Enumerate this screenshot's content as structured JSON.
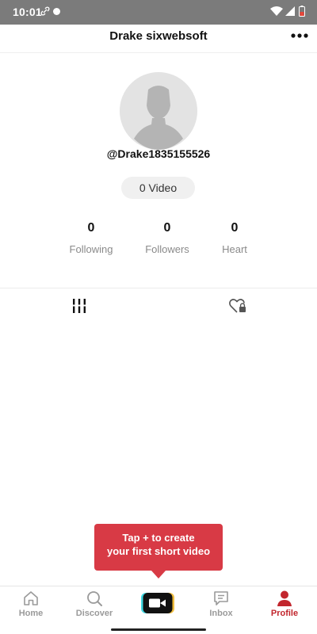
{
  "status_bar": {
    "time": "10:01"
  },
  "header": {
    "title": "Drake sixwebsoft",
    "more_icon": "more-horizontal-icon"
  },
  "profile": {
    "username": "@Drake1835155526",
    "video_count_label": "0 Video",
    "stats": [
      {
        "value": "0",
        "label": "Following"
      },
      {
        "value": "0",
        "label": "Followers"
      },
      {
        "value": "0",
        "label": "Heart"
      }
    ]
  },
  "tabs": [
    {
      "icon": "grid-columns-icon"
    },
    {
      "icon": "liked-lock-icon"
    }
  ],
  "tooltip": {
    "line1": "Tap + to create",
    "line2": "your first short video"
  },
  "bottom_nav": {
    "items": [
      {
        "label": "Home",
        "icon": "home-icon"
      },
      {
        "label": "Discover",
        "icon": "search-icon"
      },
      {
        "label": "Inbox",
        "icon": "inbox-icon"
      },
      {
        "label": "Profile",
        "icon": "profile-icon"
      }
    ],
    "active": "Profile",
    "accent_color": "#c2262d"
  },
  "colors": {
    "status_bar": "#7b7b7b",
    "tooltip": "#d83a45",
    "accent": "#c2262d"
  }
}
